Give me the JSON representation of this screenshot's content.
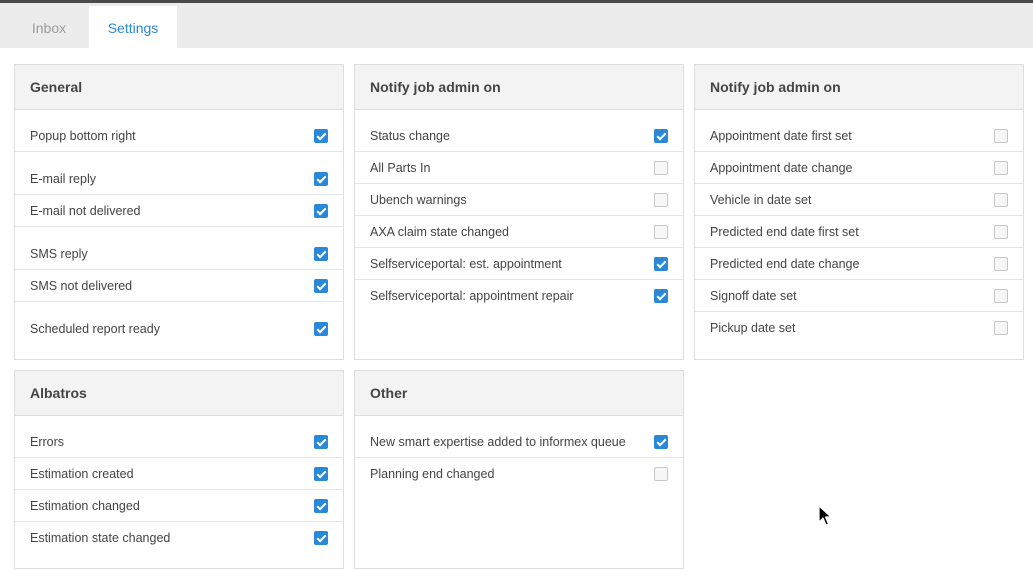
{
  "tabs": [
    {
      "label": "Inbox",
      "active": false
    },
    {
      "label": "Settings",
      "active": true
    }
  ],
  "colors": {
    "accent": "#2a88d8"
  },
  "panels": {
    "general": {
      "title": "General",
      "items": [
        {
          "label": "Popup bottom right",
          "checked": true
        },
        {
          "label": "E-mail reply",
          "checked": true
        },
        {
          "label": "E-mail not delivered",
          "checked": true
        },
        {
          "label": "SMS reply",
          "checked": true
        },
        {
          "label": "SMS not delivered",
          "checked": true
        },
        {
          "label": "Scheduled report ready",
          "checked": true
        }
      ]
    },
    "notify1": {
      "title": "Notify job admin on",
      "items": [
        {
          "label": "Status change",
          "checked": true
        },
        {
          "label": "All Parts In",
          "checked": false
        },
        {
          "label": "Ubench warnings",
          "checked": false
        },
        {
          "label": "AXA claim state changed",
          "checked": false
        },
        {
          "label": "Selfserviceportal: est. appointment",
          "checked": true
        },
        {
          "label": "Selfserviceportal: appointment repair",
          "checked": true
        }
      ]
    },
    "notify2": {
      "title": "Notify job admin on",
      "items": [
        {
          "label": "Appointment date first set",
          "checked": false
        },
        {
          "label": "Appointment date change",
          "checked": false
        },
        {
          "label": "Vehicle in date set",
          "checked": false
        },
        {
          "label": "Predicted end date first set",
          "checked": false
        },
        {
          "label": "Predicted end date change",
          "checked": false
        },
        {
          "label": "Signoff date set",
          "checked": false
        },
        {
          "label": "Pickup date set",
          "checked": false
        }
      ]
    },
    "albatros": {
      "title": "Albatros",
      "items": [
        {
          "label": "Errors",
          "checked": true
        },
        {
          "label": "Estimation created",
          "checked": true
        },
        {
          "label": "Estimation changed",
          "checked": true
        },
        {
          "label": "Estimation state changed",
          "checked": true
        }
      ]
    },
    "other": {
      "title": "Other",
      "items": [
        {
          "label": "New smart expertise added to informex queue",
          "checked": true
        },
        {
          "label": "Planning end changed",
          "checked": false
        }
      ]
    }
  }
}
